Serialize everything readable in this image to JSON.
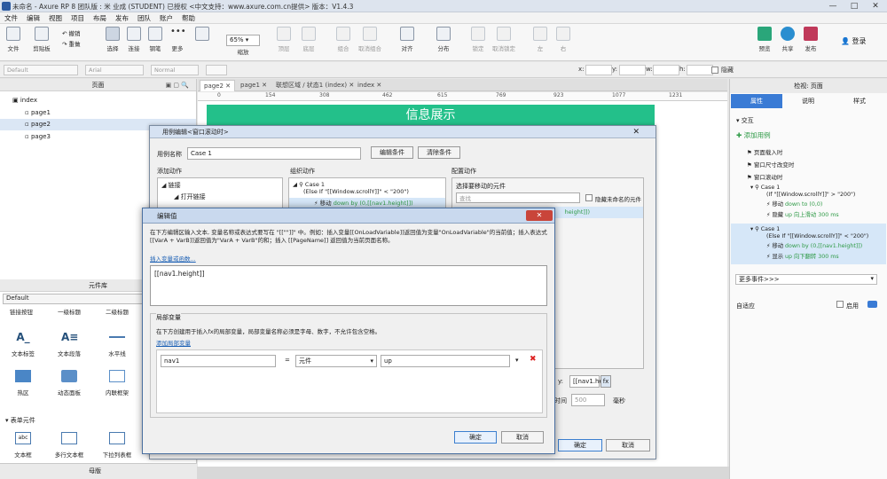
{
  "window": {
    "title": "未命名 - Axure RP 8 团队版 : 米 业成 (STUDENT) 已授权    <中文支持：www.axure.com.cn提供> 版本：V1.4.3"
  },
  "menu": [
    "文件",
    "编辑",
    "视图",
    "项目",
    "布局",
    "发布",
    "团队",
    "账户",
    "帮助"
  ],
  "toolbar": {
    "file": "文件",
    "clipboard": "剪贴板",
    "undo": "撤销",
    "redo": "重做",
    "select": "选择",
    "connect": "连接",
    "pen": "钢笔",
    "more": "更多",
    "zoom": "65%",
    "zoom_label": "缩放",
    "top": "顶层",
    "bottom": "底层",
    "group": "组合",
    "ungroup": "取消组合",
    "align": "对齐",
    "distribute": "分布",
    "lock": "锁定",
    "unlock": "取消锁定",
    "left": "左",
    "right": "右",
    "preview": "预览",
    "share": "共享",
    "publish": "发布",
    "login": "登录"
  },
  "format": {
    "style": "Default",
    "font": "Arial",
    "weight": "Normal",
    "x": "x:",
    "y": "y:",
    "w": "w:",
    "h": "h:",
    "hide": "隐藏"
  },
  "pages": {
    "title": "页面",
    "items": [
      "index",
      "page1",
      "page2",
      "page3"
    ]
  },
  "library": {
    "title": "元件库",
    "select": "Default",
    "row0": [
      "链接按钮",
      "一级标题",
      "二级标题"
    ],
    "row1": [
      "文本标签",
      "文本段落",
      "水平线"
    ],
    "row2": [
      "热区",
      "动态面板",
      "内联框架"
    ],
    "section": "表单元件",
    "row3": [
      "文本框",
      "多行文本框",
      "下拉列表框"
    ],
    "master": "母版"
  },
  "tabs": [
    "page2",
    "page1",
    "联想区域 / 状态1 (index)",
    "index"
  ],
  "ruler": [
    "0",
    "154",
    "308",
    "462",
    "615",
    "769",
    "923",
    "1077",
    "1231"
  ],
  "canvas": {
    "banner": "信息展示"
  },
  "right": {
    "header": "检视: 页面",
    "tabs": [
      "属性",
      "说明",
      "样式"
    ],
    "interact": "交互",
    "add_case": "添加用例",
    "events": [
      "页面载入时",
      "窗口尺寸改变时",
      "窗口滚动时"
    ],
    "case1": {
      "name": "Case 1",
      "cond": "(If \"[[Window.scrollY]]\" > \"200\")",
      "a1": "移动",
      "a1v": "down to (0,0)",
      "a2": "隐藏",
      "a2v": "up 向上滑动 300 ms"
    },
    "case2": {
      "name": "Case 1",
      "cond": "(Else If \"[[Window.scrollY]]\" < \"200\")",
      "a1": "移动",
      "a1v": "down by (0,[[nav1.height]])",
      "a2": "显示",
      "a2v": "up 向下翻转 300 ms"
    },
    "more": "更多事件>>>",
    "adaptive": "自适应",
    "enable": "启用"
  },
  "uce": {
    "title": "用例编辑<窗口滚动时>",
    "name_label": "用例名称",
    "name": "Case 1",
    "edit_cond": "编辑条件",
    "clear_cond": "清除条件",
    "add_action": "添加动作",
    "organize": "组织动作",
    "configure": "配置动作",
    "link": "链接",
    "open_link": "打开链接",
    "case": "Case 1",
    "case_cond": "(Else If \"[[Window.scrollY]]\" < \"200\")",
    "move": "移动",
    "move_v": "down by (0,[[nav1.height]])",
    "select_el": "选择要移动的元件",
    "search": "查找",
    "hide_unnamed": "隐藏未命名的元件",
    "right_val": "height]])",
    "y_label": "y:",
    "y_val": "[[nav1.he",
    "fx": "fx",
    "time_label": "时间",
    "time": "500",
    "ms": "毫秒",
    "ok": "确定",
    "cancel": "取消"
  },
  "ev": {
    "title": "编辑值",
    "desc": "在下方编辑区输入文本, 变量名称或表达式要写在 \"[[\"\"]]\" 中。例如：插入变量[[OnLoadVariable]]返回值为变量\"OnLoadVariable\"的当前值；插入表达式[[VarA + VarB]]返回值为\"VarA + VarB\"的和；插入 [[PageName]] 返回值为当前页面名称。",
    "insert": "插入变量或函数...",
    "value": "[[nav1.height]]",
    "local": "局部变量",
    "local_desc": "在下方创建用于插入fx的局部变量，局部变量名称必须是字母、数字，不允许包含空格。",
    "add_local": "添加局部变量",
    "var_name": "nav1",
    "eq": "=",
    "type": "元件",
    "target": "up",
    "ok": "确定",
    "cancel": "取消"
  }
}
